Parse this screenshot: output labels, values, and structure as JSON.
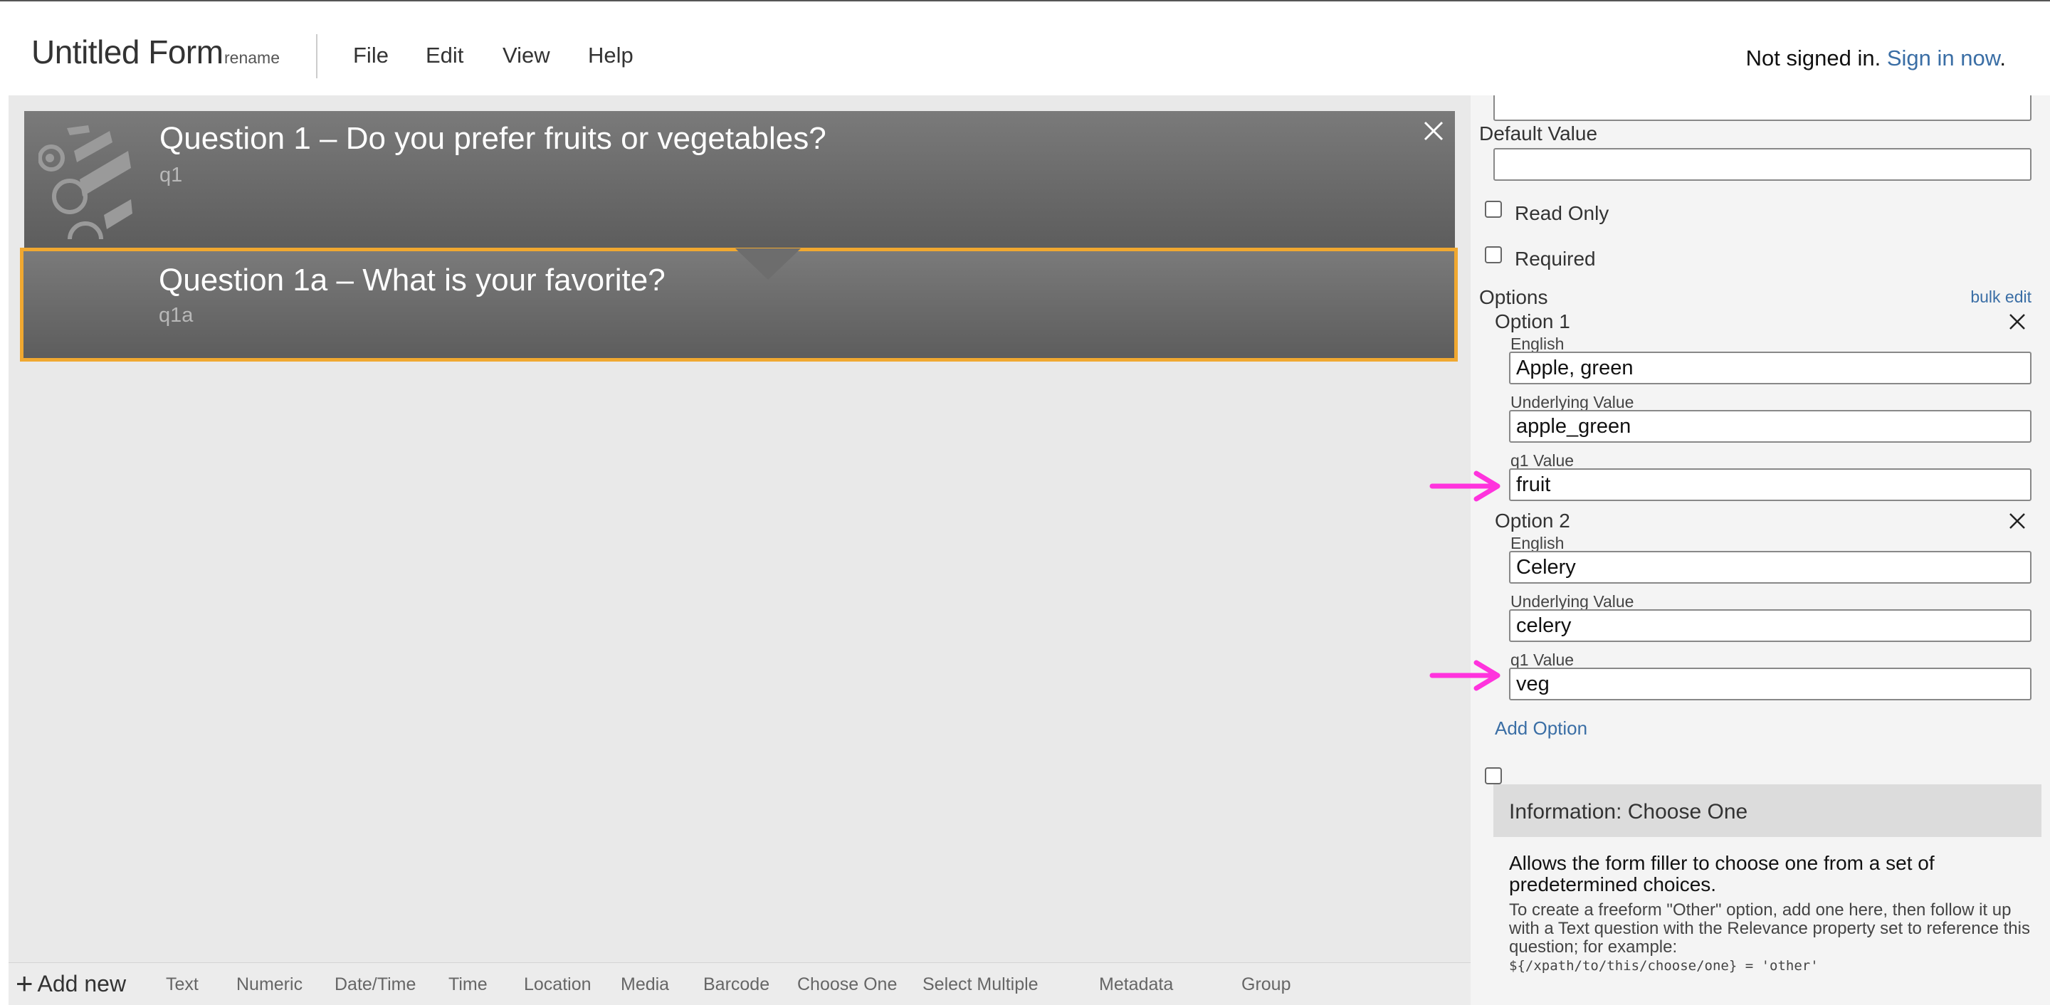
{
  "header": {
    "title": "Untitled Form",
    "rename": "rename",
    "menu": [
      "File",
      "Edit",
      "View",
      "Help"
    ],
    "auth_status": "Not signed in.",
    "sign_in": "Sign in now",
    "sign_in_suffix": "."
  },
  "questions": [
    {
      "title": "Question 1 – Do you prefer fruits or vegetables?",
      "name": "q1"
    },
    {
      "title": "Question 1a – What is your favorite?",
      "name": "q1a"
    }
  ],
  "toolbar": {
    "add_new": "Add new",
    "plus": "+",
    "items": [
      "Text",
      "Numeric",
      "Date/Time",
      "Time",
      "Location",
      "Media",
      "Barcode",
      "Choose One",
      "Select Multiple",
      "Metadata",
      "Group"
    ]
  },
  "properties": {
    "default_value_label": "Default Value",
    "default_value": "",
    "read_only_label": "Read Only",
    "required_label": "Required",
    "options_label": "Options",
    "bulk_edit": "bulk edit",
    "options": [
      {
        "heading": "Option 1",
        "english_label": "English",
        "english": "Apple, green",
        "underlying_label": "Underlying Value",
        "underlying": "apple_green",
        "q1_label": "q1 Value",
        "q1": "fruit"
      },
      {
        "heading": "Option 2",
        "english_label": "English",
        "english": "Celery",
        "underlying_label": "Underlying Value",
        "underlying": "celery",
        "q1_label": "q1 Value",
        "q1": "veg"
      }
    ],
    "add_option": "Add Option"
  },
  "info": {
    "title": "Information: Choose One",
    "description": "Allows the form filler to choose one from a set of predetermined choices.",
    "note": "To create a freeform \"Other\" option, add one here, then follow it up with a Text question with the Relevance property set to reference this question; for example:",
    "code": "${/xpath/to/this/choose/one} = 'other'"
  },
  "colors": {
    "selection_border": "#f0a830",
    "annotation_arrow": "#ff33dd",
    "link": "#3a6ea5"
  }
}
